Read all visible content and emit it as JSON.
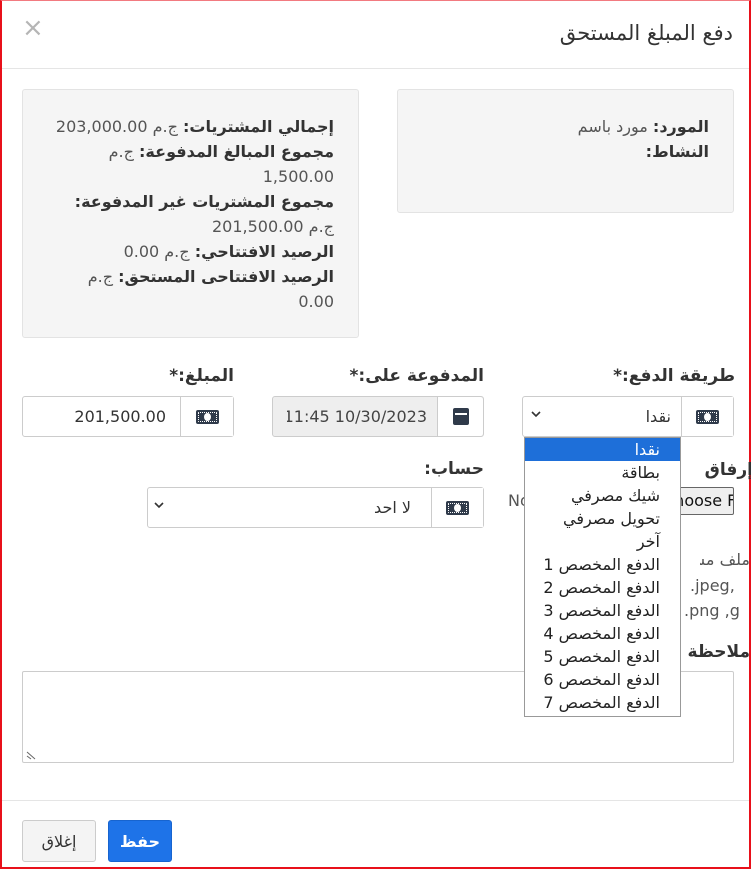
{
  "modal": {
    "title": "دفع المبلغ المستحق",
    "close_glyph": "×"
  },
  "supplier_box": {
    "supplier_label": "المورد:",
    "supplier_value": "مورد باسم",
    "activity_label": "النشاط:"
  },
  "summary_box": {
    "total_purchases_label": "إجمالي المشتريات:",
    "total_purchases_value": "ج.م 203,000.00",
    "total_paid_label": "مجموع المبالغ المدفوعة:",
    "total_paid_currency": "ج.م",
    "total_paid_value": "1,500.00",
    "unpaid_label": "مجموع المشتريات غير المدفوعة:",
    "unpaid_value": "ج.م 201,500.00",
    "opening_balance_label": "الرصيد الافتتاحي:",
    "opening_balance_value": "ج.م 0.00",
    "opening_due_label": "الرصيد الافتتاحى المستحق:",
    "opening_due_currency": "ج.م",
    "opening_due_value": "0.00"
  },
  "form": {
    "payment_method_label": "طريقة الدفع:*",
    "payment_method_value": "نقدا",
    "paid_on_label": "المدفوعة على:*",
    "paid_on_value": "10/30/2023 11:45",
    "amount_label": "المبلغ:*",
    "amount_value": "201,500.00",
    "attach_label": "إرفاق",
    "file_button_label": "Choose File",
    "no_file_text": "No",
    "account_label": "حساب:",
    "account_value": "لا احد",
    "file_hint_1": "ملف مس",
    "file_hint_2": ".jpeg,",
    "file_hint_3": ".png ,g",
    "notes_label": "ملاحظة"
  },
  "payment_options": [
    "نقدا",
    "بطاقة",
    "شيك مصرفي",
    "تحويل مصرفي",
    "آخر",
    "الدفع المخصص 1",
    "الدفع المخصص 2",
    "الدفع المخصص 3",
    "الدفع المخصص 4",
    "الدفع المخصص 5",
    "الدفع المخصص 6",
    "الدفع المخصص 7"
  ],
  "footer": {
    "save_label": "حفظ",
    "close_label": "إغلاق"
  },
  "colors": {
    "primary": "#1e73e8",
    "frame_border": "#e8101a",
    "selected_option": "#1e6fd9"
  }
}
